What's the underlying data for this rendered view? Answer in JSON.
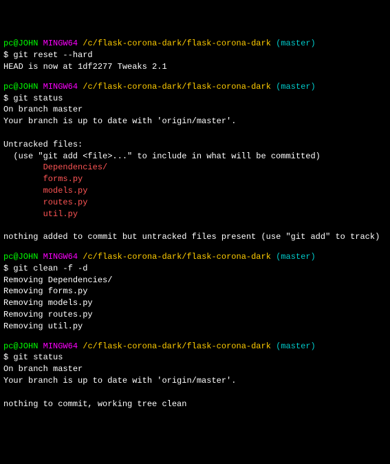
{
  "prompt": {
    "user": "pc@JOHN",
    "env": "MINGW64",
    "path": "/c/flask-corona-dark/flask-corona-dark",
    "branch": "(master)",
    "symbol": "$"
  },
  "blocks": [
    {
      "command": "git reset --hard",
      "output": [
        "HEAD is now at 1df2277 Tweaks 2.1"
      ]
    },
    {
      "command": "git status",
      "output": [
        "On branch master",
        "Your branch is up to date with 'origin/master'.",
        "",
        "Untracked files:"
      ],
      "hint": "(use \"git add <file>...\" to include in what will be committed)",
      "untracked": [
        "Dependencies/",
        "forms.py",
        "models.py",
        "routes.py",
        "util.py"
      ],
      "tail": [
        "",
        "nothing added to commit but untracked files present (use \"git add\" to track)"
      ]
    },
    {
      "command": "git clean -f -d",
      "output": [
        "Removing Dependencies/",
        "Removing forms.py",
        "Removing models.py",
        "Removing routes.py",
        "Removing util.py"
      ]
    },
    {
      "command": "git status",
      "output": [
        "On branch master",
        "Your branch is up to date with 'origin/master'.",
        "",
        "nothing to commit, working tree clean"
      ]
    }
  ]
}
